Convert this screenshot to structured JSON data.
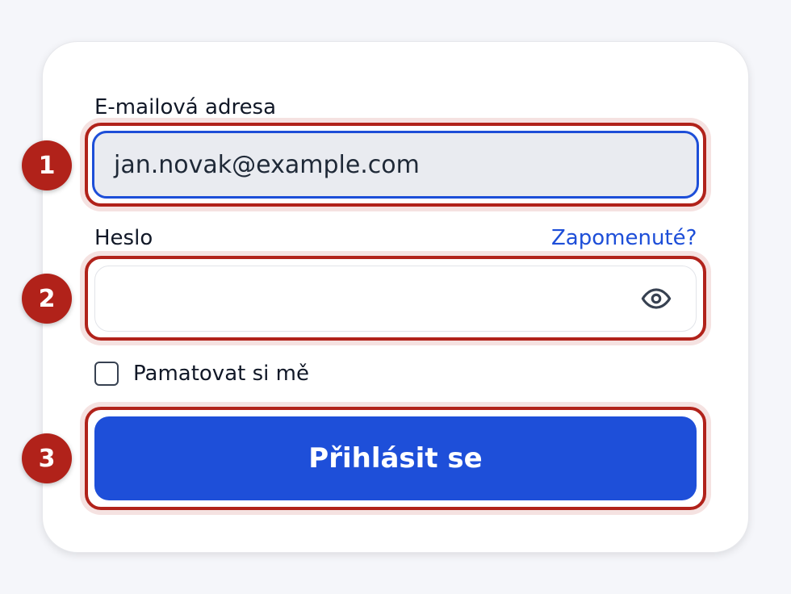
{
  "form": {
    "email_label": "E-mailová adresa",
    "email_value": "jan.novak@example.com",
    "password_label": "Heslo",
    "forgot_link": "Zapomenuté?",
    "password_value": "",
    "remember_label": "Pamatovat si mě",
    "remember_checked": false,
    "submit_label": "Přihlásit se"
  },
  "annotations": {
    "badges": [
      "1",
      "2",
      "3"
    ]
  },
  "colors": {
    "accent": "#1e4fd9",
    "link": "#1d4ed8",
    "callout": "#b1221a",
    "page_background": "#f5f6fa"
  },
  "icons": {
    "password_toggle": "eye-icon"
  }
}
